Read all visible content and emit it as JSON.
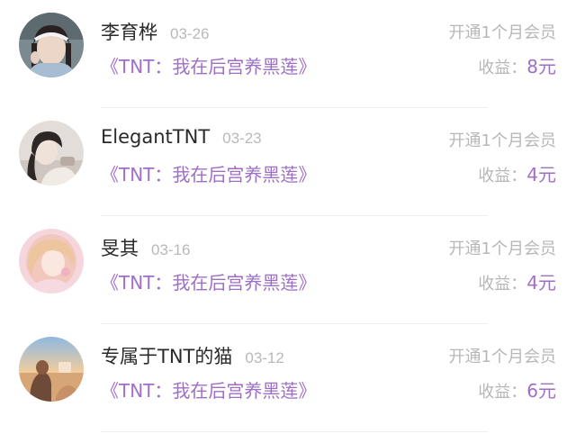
{
  "entries": [
    {
      "name": "李育桦",
      "date": "03-26",
      "novel": "《TNT：我在后宫养黑莲》",
      "action": "开通1个月会员",
      "earn_label": "收益：",
      "amount": "8元",
      "avatar_palette": [
        "#6f7c80",
        "#e9d3c6",
        "#2c2424",
        "#9ab0c4"
      ]
    },
    {
      "name": "ElegantTNT",
      "date": "03-23",
      "novel": "《TNT：我在后宫养黑莲》",
      "action": "开通1个月会员",
      "earn_label": "收益：",
      "amount": "4元",
      "avatar_palette": [
        "#d8d4d0",
        "#efe7e1",
        "#3a302e",
        "#c8bcb8"
      ]
    },
    {
      "name": "旻其",
      "date": "03-16",
      "novel": "《TNT：我在后宫养黑莲》",
      "action": "开通1个月会员",
      "earn_label": "收益：",
      "amount": "4元",
      "avatar_palette": [
        "#f4cdd6",
        "#fbe6e8",
        "#f2d1b8",
        "#e7a9b7"
      ]
    },
    {
      "name": "专属于TNT的猫",
      "date": "03-12",
      "novel": "《TNT：我在后宫养黑莲》",
      "action": "开通1个月会员",
      "earn_label": "收益：",
      "amount": "6元",
      "avatar_palette": [
        "#9fc3e3",
        "#f1c99b",
        "#6b4b3a",
        "#c99b72"
      ]
    }
  ],
  "colors": {
    "accent": "#9f6fc8",
    "muted": "#b7b7b7",
    "name": "#2a2a2a",
    "divider": "#efefef"
  }
}
